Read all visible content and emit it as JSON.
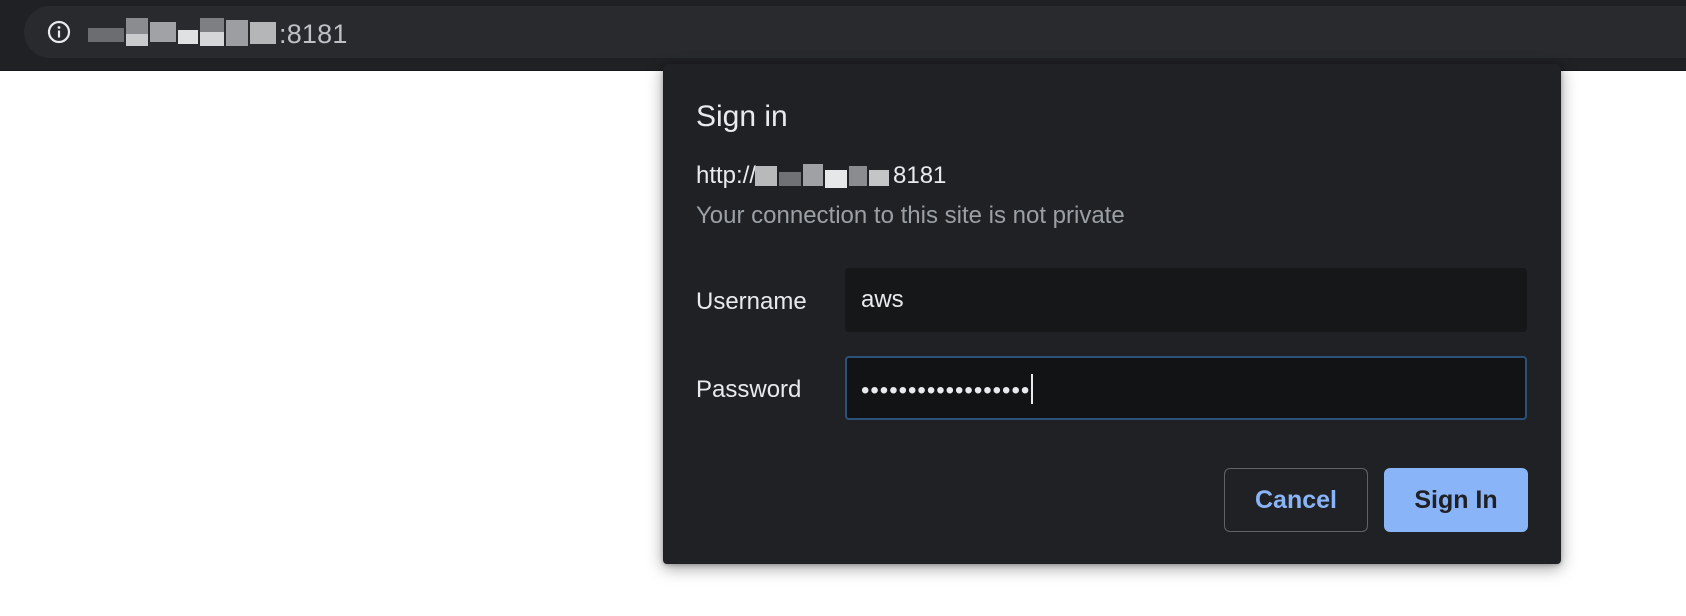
{
  "browser": {
    "url_suffix": ":8181",
    "site_info_icon": "info-icon"
  },
  "dialog": {
    "title": "Sign in",
    "origin_prefix": "http://",
    "origin_suffix": "8181",
    "warning": "Your connection to this site is not private",
    "username_label": "Username",
    "username_value": "aws",
    "password_label": "Password",
    "password_value": "••••••••••••••••••",
    "cancel_label": "Cancel",
    "signin_label": "Sign In"
  },
  "colors": {
    "dialog_bg": "#202124",
    "accent": "#8ab4f8",
    "focus_border": "#2d5078"
  }
}
